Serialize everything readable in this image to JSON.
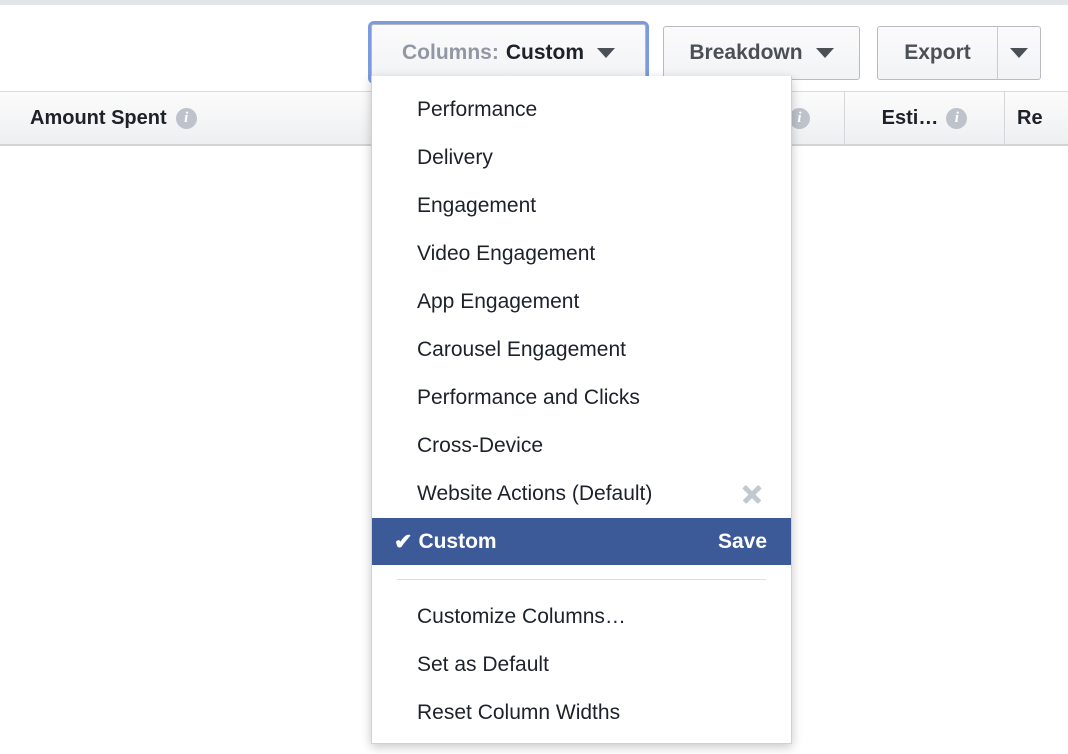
{
  "toolbar": {
    "columns_button": {
      "prefix": "Columns:",
      "value": "Custom",
      "caret_icon": "chevron-down-icon"
    },
    "breakdown_button": {
      "label": "Breakdown",
      "caret_icon": "chevron-down-icon"
    },
    "export_button": {
      "label": "Export",
      "caret_icon": "chevron-down-icon"
    }
  },
  "table_header": {
    "columns": [
      {
        "label": "Amount Spent",
        "info_icon": "info-icon"
      },
      {
        "label": "Esti…",
        "info_icon": "info-icon"
      },
      {
        "label": "Re",
        "info_icon": ""
      }
    ]
  },
  "columns_menu": {
    "presets": [
      {
        "label": "Performance",
        "removable": false,
        "selected": false
      },
      {
        "label": "Delivery",
        "removable": false,
        "selected": false
      },
      {
        "label": "Engagement",
        "removable": false,
        "selected": false
      },
      {
        "label": "Video Engagement",
        "removable": false,
        "selected": false
      },
      {
        "label": "App Engagement",
        "removable": false,
        "selected": false
      },
      {
        "label": "Carousel Engagement",
        "removable": false,
        "selected": false
      },
      {
        "label": "Performance and Clicks",
        "removable": false,
        "selected": false
      },
      {
        "label": "Cross-Device",
        "removable": false,
        "selected": false
      },
      {
        "label": "Website Actions (Default)",
        "removable": true,
        "selected": false
      }
    ],
    "selected_item": {
      "label": "Custom",
      "check_glyph": "✔",
      "save_label": "Save"
    },
    "actions": [
      {
        "label": "Customize Columns…"
      },
      {
        "label": "Set as Default"
      },
      {
        "label": "Reset Column Widths"
      }
    ]
  },
  "colors": {
    "selection_blue": "#3d5a98",
    "focus_ring_blue": "#6588d9",
    "info_icon_grey": "#bec3cb",
    "text_dark": "#1d2129",
    "text_muted": "#9197a3"
  }
}
